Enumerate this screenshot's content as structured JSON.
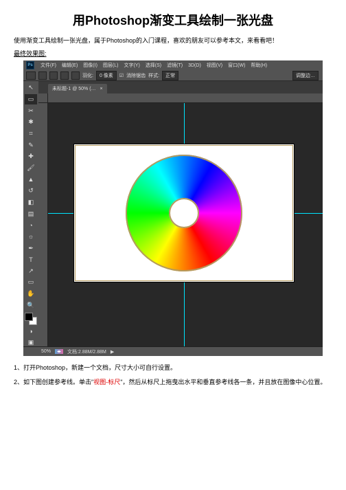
{
  "title": "用Photoshop渐变工具绘制一张光盘",
  "intro": "使用渐变工具绘制一张光盘，属于Photoshop的入门课程，喜欢的朋友可以参考本文，来看看吧！",
  "result_label": "最终效果图:",
  "menubar": {
    "logo": "Ps",
    "items": [
      "文件(F)",
      "编辑(E)",
      "图像(I)",
      "图层(L)",
      "文字(Y)",
      "选择(S)",
      "滤镜(T)",
      "3D(D)",
      "视图(V)",
      "窗口(W)",
      "帮助(H)"
    ]
  },
  "optbar": {
    "feather_label": "羽化:",
    "feather_value": "0 像素",
    "antialias": "消除锯齿",
    "style_label": "样式:",
    "style_value": "正常",
    "refine": "调整边…"
  },
  "tab": {
    "title": "未标题-1",
    "mode": "@ 50% (…"
  },
  "status": {
    "zoom": "50%",
    "doc": "文档:2.88M/2.88M"
  },
  "steps": {
    "s1_prefix": "1、打开Photoshop，新建一个文档，尺寸大小可自行设置。",
    "s2_a": "2、如下图创建参考线。单击\"",
    "s2_red": "视图-标尺",
    "s2_b": "\"，然后从标尺上拖曳出水平和垂直参考线各一条，并且放在图像中心位置。"
  }
}
